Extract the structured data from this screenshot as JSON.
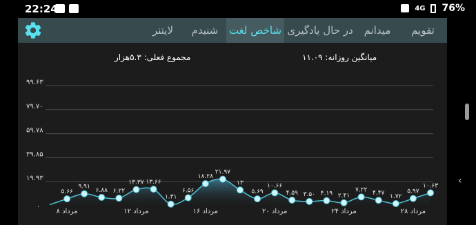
{
  "status_bar": {
    "time": "22:24",
    "network": "4G",
    "battery": "76%"
  },
  "app": {
    "settings_icon": "gear-icon",
    "accent_color": "#58e0ef",
    "tabs": [
      {
        "label": "تقویم",
        "active": false
      },
      {
        "label": "میدانم",
        "active": false
      },
      {
        "label": "در حال یادگیری",
        "active": false
      },
      {
        "label": "شاخص لغت",
        "active": true
      },
      {
        "label": "شنیدم",
        "active": false
      },
      {
        "label": "لایتنر",
        "active": false
      }
    ],
    "summary": {
      "total": "مجموع فعلی: ۵.۳هزار",
      "daily_average": "میانگین روزانه: ۱۱.۰۹"
    }
  },
  "chart_data": {
    "type": "area",
    "title": "",
    "xlabel": "",
    "ylabel": "",
    "y_ticks": [
      "۹۹.۶۳",
      "۷۹.۷۰",
      "۵۹.۷۸",
      "۳۹.۸۵",
      "۱۹.۹۳"
    ],
    "ylim": [
      0,
      99.63
    ],
    "x_tick_labels": [
      "۸ مرداد",
      "۱۲ مرداد",
      "۱۶ مرداد",
      "۲۰ مرداد",
      "۲۴ مرداد",
      "۲۸ مرداد"
    ],
    "grid": true,
    "series": [
      {
        "values": [
          0.8,
          5.66,
          9.91,
          6.88,
          6.22,
          13.37,
          13.66,
          1.31,
          6.56,
          18.28,
          21.97,
          13.0,
          5.69,
          10.66,
          4.59,
          3.5,
          4.19,
          2.41,
          7.22,
          4.47,
          1.72,
          5.97,
          10.63
        ],
        "labels": [
          "",
          "۵.۶۶",
          "۹.۹۱",
          "۶.۸۸",
          "۶.۲۲",
          "۱۳.۳۷",
          "۱۳.۶۶",
          "۱.۳۱",
          "۶.۵۶",
          "۱۸.۲۸",
          "۲۱.۹۷",
          "۱۳",
          "۵.۶۹",
          "۱۰.۶۶",
          "۴.۵۹",
          "۳.۵۰",
          "۴.۱۹",
          "۲.۴۱",
          "۷.۲۲",
          "۴.۴۷",
          "۱.۷۲",
          "۵.۹۷",
          "۱۰.۶۳"
        ]
      }
    ]
  }
}
